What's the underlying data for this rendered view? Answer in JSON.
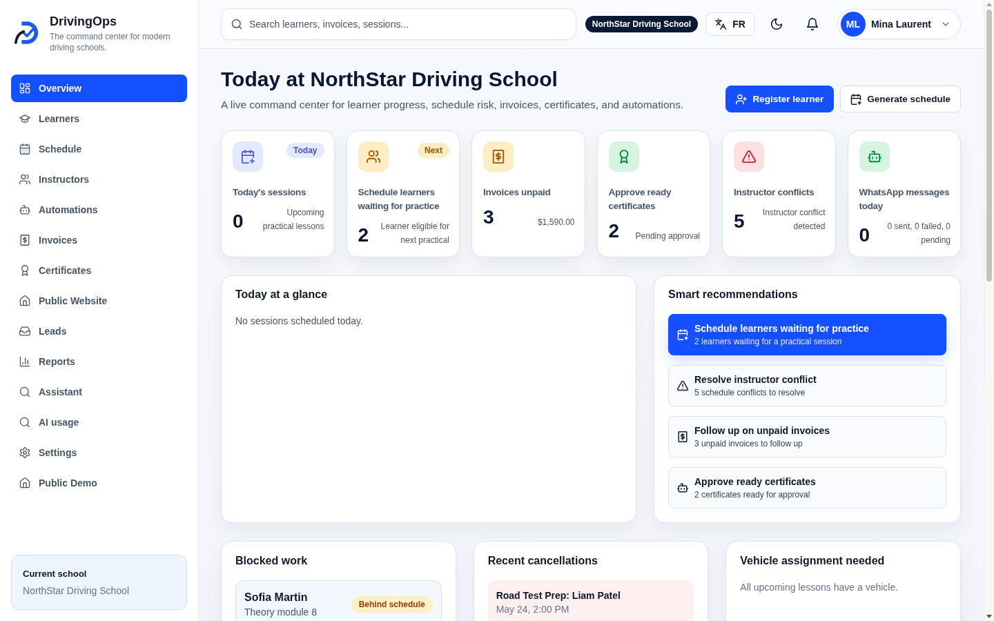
{
  "sidebar": {
    "brand": {
      "name": "DrivingOps",
      "tagline": "The command center for modern driving schools."
    },
    "nav": [
      {
        "label": "Overview",
        "selected": true
      },
      {
        "label": "Learners",
        "selected": false
      },
      {
        "label": "Schedule",
        "selected": false
      },
      {
        "label": "Instructors",
        "selected": false
      },
      {
        "label": "Automations",
        "selected": false
      },
      {
        "label": "Invoices",
        "selected": false
      },
      {
        "label": "Certificates",
        "selected": false
      },
      {
        "label": "Public Website",
        "selected": false
      },
      {
        "label": "Leads",
        "selected": false
      },
      {
        "label": "Reports",
        "selected": false
      },
      {
        "label": "Assistant",
        "selected": false
      },
      {
        "label": "AI usage",
        "selected": false
      },
      {
        "label": "Settings",
        "selected": false
      },
      {
        "label": "Public Demo",
        "selected": false
      }
    ],
    "current_school": {
      "label": "Current school",
      "value": "NorthStar Driving School"
    }
  },
  "topbar": {
    "search": {
      "placeholder": "Search learners, invoices, sessions..."
    },
    "school_badge": "NorthStar Driving School",
    "language": "FR",
    "user": {
      "initials": "ML",
      "name": "Mina Laurent"
    }
  },
  "header": {
    "title": "Today at NorthStar Driving School",
    "subtitle": "A live command center for learner progress, schedule risk, invoices, certificates, and automations.",
    "actions": [
      {
        "label": "Register learner",
        "kind": "primary"
      },
      {
        "label": "Generate schedule",
        "kind": "secondary"
      }
    ]
  },
  "stats": [
    {
      "title": "Today's sessions",
      "value": "0",
      "note": "Upcoming practical lessons",
      "badge": "Today",
      "color": "#e3e9ff"
    },
    {
      "title": "Schedule learners waiting for practice",
      "value": "2",
      "note": "Learner eligible for next practical",
      "badge": "Next",
      "color": "#fdecc4"
    },
    {
      "title": "Invoices unpaid",
      "value": "3",
      "note": "$1,590.00",
      "color": "#fdecc4"
    },
    {
      "title": "Approve ready certificates",
      "value": "2",
      "note": "Pending approval",
      "color": "#d5f5e1"
    },
    {
      "title": "Instructor conflicts",
      "value": "5",
      "note": "Instructor conflict detected",
      "color": "#fde1e1"
    },
    {
      "title": "WhatsApp messages today",
      "value": "0",
      "note": "0 sent, 0 failed, 0 pending",
      "color": "#d5f5e1"
    }
  ],
  "glance": {
    "title": "Today at a glance",
    "message": "No sessions scheduled today."
  },
  "recommendations": {
    "title": "Smart recommendations",
    "items": [
      {
        "title": "Schedule learners waiting for practice",
        "detail": "2 learners waiting for a practical session",
        "selected": true
      },
      {
        "title": "Resolve instructor conflict",
        "detail": "5 schedule conflicts to resolve",
        "selected": false
      },
      {
        "title": "Follow up on unpaid invoices",
        "detail": "3 unpaid invoices to follow up",
        "selected": false
      },
      {
        "title": "Approve ready certificates",
        "detail": "2 certificates ready for approval",
        "selected": false
      }
    ]
  },
  "blocked_work": {
    "title": "Blocked work",
    "items": [
      {
        "name": "Sofia Martin",
        "detail": "Theory module 8",
        "status": "Behind schedule"
      }
    ]
  },
  "cancellations": {
    "title": "Recent cancellations",
    "items": [
      {
        "title": "Road Test Prep: Liam Patel",
        "time": "May 24, 2:00 PM"
      }
    ]
  },
  "vehicle_assignment": {
    "title": "Vehicle assignment needed",
    "message": "All upcoming lessons have a vehicle."
  }
}
